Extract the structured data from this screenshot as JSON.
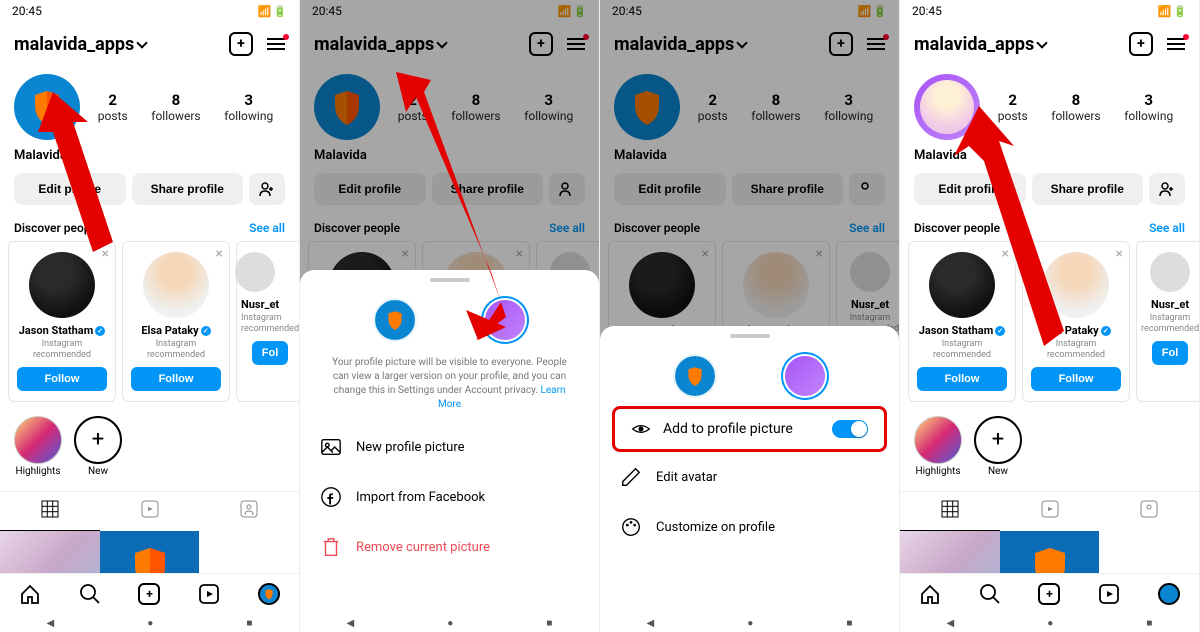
{
  "status": {
    "time": "20:45",
    "icons": "▤ ▸ ◆ ▮"
  },
  "header": {
    "username": "malavida_apps"
  },
  "profile": {
    "stats": [
      {
        "num": "2",
        "lbl": "posts"
      },
      {
        "num": "8",
        "lbl": "followers"
      },
      {
        "num": "3",
        "lbl": "following"
      }
    ],
    "name": "Malavida",
    "edit": "Edit profile",
    "share": "Share profile"
  },
  "discover": {
    "title": "Discover people",
    "see_all": "See all"
  },
  "suggestions": [
    {
      "name": "Jason Statham",
      "meta": "Instagram recommended",
      "btn": "Follow"
    },
    {
      "name": "Elsa Pataky",
      "meta": "Instagram recommended",
      "btn": "Follow"
    },
    {
      "name": "Nusr_et",
      "meta": "Instagram recommended",
      "btn": "Fol"
    }
  ],
  "highlights": {
    "first": "Highlights",
    "new": "New"
  },
  "sheet1": {
    "text": "Your profile picture will be visible to everyone. People can view a larger version on your profile, and you can change this in Settings under Account privacy.",
    "learn": "Learn More",
    "items": {
      "new": "New profile picture",
      "fb": "Import from Facebook",
      "remove": "Remove current picture"
    }
  },
  "sheet2": {
    "toggle": "Add to profile picture",
    "items": {
      "edit": "Edit avatar",
      "customize": "Customize on profile"
    }
  }
}
